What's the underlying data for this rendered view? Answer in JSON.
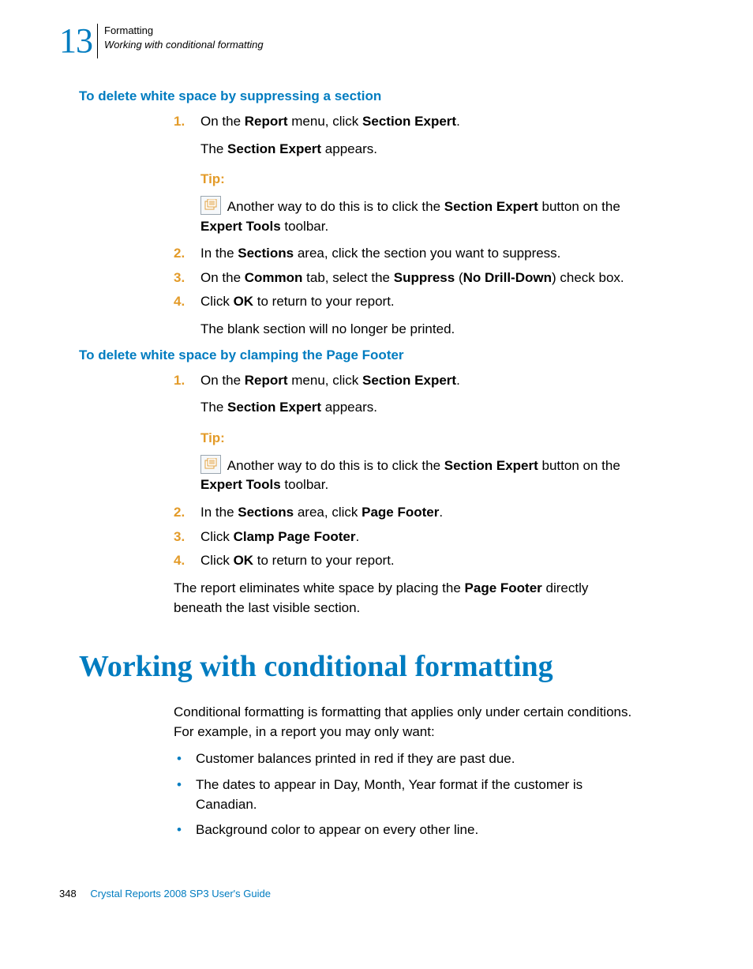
{
  "header": {
    "chapter_number": "13",
    "chapter_title": "Formatting",
    "section_title": "Working with conditional formatting"
  },
  "sec1": {
    "heading": "To delete white space by suppressing a section",
    "step1_pre": "On the ",
    "step1_b1": "Report",
    "step1_mid": " menu, click ",
    "step1_b2": "Section Expert",
    "step1_post": ".",
    "p1_pre": "The ",
    "p1_b": "Section Expert",
    "p1_post": " appears.",
    "tip_label": "Tip:",
    "tip_pre": " Another way to do this is to click the ",
    "tip_b1": "Section Expert",
    "tip_mid": " button on the ",
    "tip_b2": "Expert Tools",
    "tip_post": " toolbar.",
    "step2_pre": "In the ",
    "step2_b1": "Sections",
    "step2_post": " area, click the section you want to suppress.",
    "step3_pre": "On the ",
    "step3_b1": "Common",
    "step3_mid": " tab, select the ",
    "step3_b2": "Suppress",
    "step3_paren_open": " (",
    "step3_b3": "No Drill-Down",
    "step3_post": ") check box.",
    "step4_pre": "Click ",
    "step4_b1": "OK",
    "step4_post": " to return to your report.",
    "p2": "The blank section will no longer be printed."
  },
  "sec2": {
    "heading": "To delete white space by clamping the Page Footer",
    "step1_pre": "On the ",
    "step1_b1": "Report",
    "step1_mid": " menu, click ",
    "step1_b2": "Section Expert",
    "step1_post": ".",
    "p1_pre": "The ",
    "p1_b": "Section Expert",
    "p1_post": " appears.",
    "tip_label": "Tip:",
    "tip_pre": " Another way to do this is to click the ",
    "tip_b1": "Section Expert",
    "tip_mid": " button on the ",
    "tip_b2": "Expert Tools",
    "tip_post": " toolbar.",
    "step2_pre": "In the ",
    "step2_b1": "Sections",
    "step2_mid": " area, click ",
    "step2_b2": "Page Footer",
    "step2_post": ".",
    "step3_pre": "Click ",
    "step3_b1": "Clamp Page Footer",
    "step3_post": ".",
    "step4_pre": "Click ",
    "step4_b1": "OK",
    "step4_post": " to return to your report.",
    "p2_pre": "The report eliminates white space by placing the ",
    "p2_b": "Page Footer",
    "p2_post": " directly beneath the last visible section."
  },
  "main": {
    "heading": "Working with conditional formatting",
    "intro": "Conditional formatting is formatting that applies only under certain conditions. For example, in a report you may only want:",
    "bullets": [
      "Customer balances printed in red if they are past due.",
      "The dates to appear in Day, Month, Year format if the customer is Canadian.",
      "Background color to appear on every other line."
    ]
  },
  "footer": {
    "page": "348",
    "book": "Crystal Reports 2008 SP3 User's Guide"
  },
  "nums": {
    "n1": "1.",
    "n2": "2.",
    "n3": "3.",
    "n4": "4."
  }
}
